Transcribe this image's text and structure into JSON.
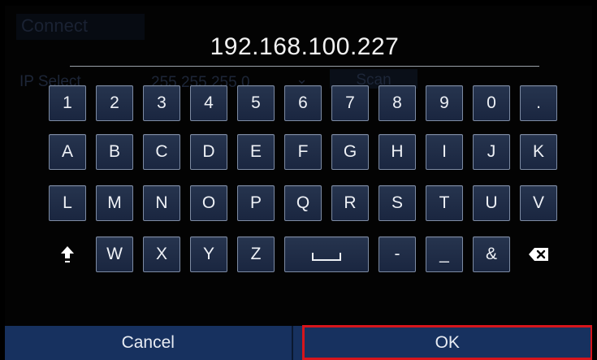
{
  "background_dialog": {
    "title": "Connect",
    "ip_select_label": "IP Select",
    "ip_select_value": "255.255.255.0",
    "scan_label": "Scan"
  },
  "ip_display": {
    "value": "192.168.100.227"
  },
  "keyboard": {
    "row1": [
      "1",
      "2",
      "3",
      "4",
      "5",
      "6",
      "7",
      "8",
      "9",
      "0",
      "."
    ],
    "row2": [
      "A",
      "B",
      "C",
      "D",
      "E",
      "F",
      "G",
      "H",
      "I",
      "J",
      "K"
    ],
    "row3": [
      "L",
      "M",
      "N",
      "O",
      "P",
      "Q",
      "R",
      "S",
      "T",
      "U",
      "V"
    ],
    "row4_left": [
      "W",
      "X",
      "Y",
      "Z"
    ],
    "row4_right": [
      "-",
      "_",
      "&"
    ],
    "shift_icon": "shift-up-arrow-icon",
    "space_icon": "space-bar-icon",
    "backspace_icon": "backspace-icon"
  },
  "bottom_bar": {
    "cancel_label": "Cancel",
    "ok_label": "OK",
    "highlight_color": "#d6151c",
    "bar_color": "#17315f"
  }
}
